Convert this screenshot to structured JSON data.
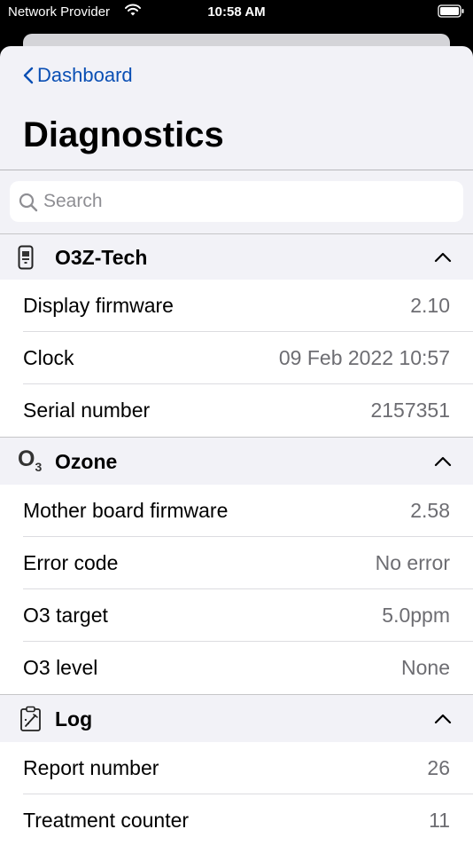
{
  "status_bar": {
    "carrier": "Network Provider",
    "time": "10:58 AM"
  },
  "nav": {
    "back_label": "Dashboard",
    "title": "Diagnostics"
  },
  "search": {
    "placeholder": "Search"
  },
  "sections": [
    {
      "title": "O3Z-Tech",
      "icon": "device-icon",
      "rows": [
        {
          "label": "Display firmware",
          "value": "2.10"
        },
        {
          "label": "Clock",
          "value": "09 Feb 2022 10:57"
        },
        {
          "label": "Serial number",
          "value": "2157351"
        }
      ]
    },
    {
      "title": "Ozone",
      "icon": "ozone-icon",
      "icon_text": "O",
      "icon_sub": "3",
      "rows": [
        {
          "label": "Mother board firmware",
          "value": "2.58"
        },
        {
          "label": "Error code",
          "value": "No error"
        },
        {
          "label": "O3 target",
          "value": "5.0ppm"
        },
        {
          "label": "O3 level",
          "value": "None"
        }
      ]
    },
    {
      "title": "Log",
      "icon": "clipboard-icon",
      "rows": [
        {
          "label": "Report number",
          "value": "26"
        },
        {
          "label": "Treatment counter",
          "value": "11"
        }
      ]
    }
  ]
}
